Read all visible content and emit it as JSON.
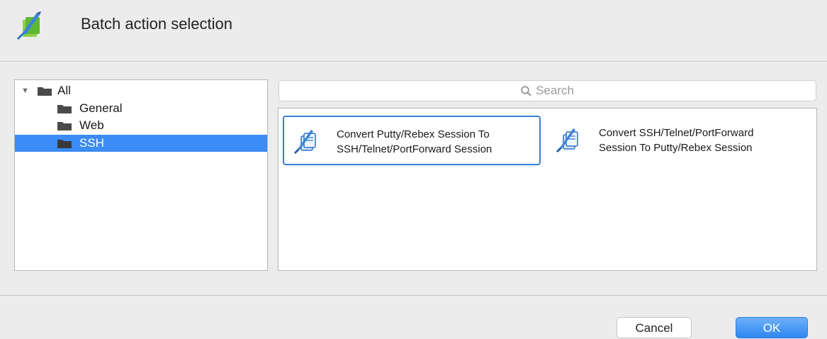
{
  "dialog": {
    "title": "Batch action selection"
  },
  "tree": {
    "items": [
      {
        "label": "All",
        "expanded": true,
        "selected": false
      },
      {
        "label": "General",
        "selected": false
      },
      {
        "label": "Web",
        "selected": false
      },
      {
        "label": "SSH",
        "selected": true
      }
    ]
  },
  "search": {
    "placeholder": "Search"
  },
  "actions": [
    {
      "label": "Convert Putty/Rebex Session To\nSSH/Telnet/PortForward Session",
      "selected": true
    },
    {
      "label": "Convert SSH/Telnet/PortForward\nSession To Putty/Rebex Session",
      "selected": false
    }
  ],
  "buttons": {
    "cancel": "Cancel",
    "ok": "OK"
  },
  "colors": {
    "accent": "#3b8cf4",
    "selection_border": "#3b7ed6"
  }
}
